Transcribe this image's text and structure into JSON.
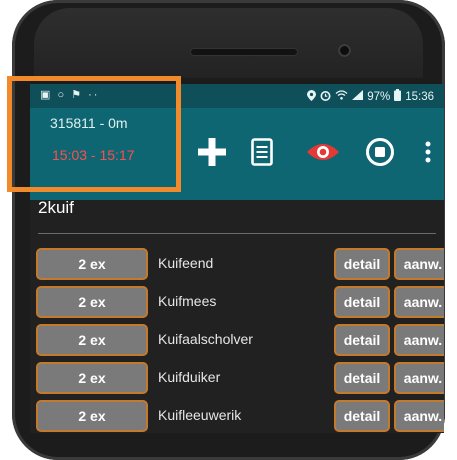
{
  "status_bar": {
    "left_icons": [
      "image-icon",
      "instagram-icon",
      "flag-icon",
      "more-dots-icon"
    ],
    "right_icons": [
      "location-icon",
      "alarm-icon",
      "wifi-icon",
      "signal-icon",
      "battery-icon"
    ],
    "battery": "97%",
    "time": "15:36"
  },
  "app_bar": {
    "subtitle_location": "315811 - 0m",
    "subtitle_time_range": "15:03 - 15:17",
    "actions": [
      {
        "name": "add",
        "icon": "plus-icon"
      },
      {
        "name": "notes",
        "icon": "document-icon"
      },
      {
        "name": "view",
        "icon": "eye-icon"
      },
      {
        "name": "stop",
        "icon": "stop-circle-icon"
      },
      {
        "name": "menu",
        "icon": "more-vertical-icon"
      }
    ],
    "colors": {
      "app_bar": "#0f6673",
      "status_bar": "#0f4f5a",
      "time_range": "#ff4d4d",
      "eye": "#e53935"
    }
  },
  "section": {
    "title": "2kuif"
  },
  "rows": [
    {
      "qty": "2 ex",
      "species": "Kuifeend",
      "detail": "detail",
      "aanw": "aanw."
    },
    {
      "qty": "2 ex",
      "species": "Kuifmees",
      "detail": "detail",
      "aanw": "aanw."
    },
    {
      "qty": "2 ex",
      "species": "Kuifaalscholver",
      "detail": "detail",
      "aanw": "aanw."
    },
    {
      "qty": "2 ex",
      "species": "Kuifduiker",
      "detail": "detail",
      "aanw": "aanw."
    },
    {
      "qty": "2 ex",
      "species": "Kuifleeuwerik",
      "detail": "detail",
      "aanw": "aanw."
    }
  ],
  "highlight_color": "#f08a2a",
  "button_border_color": "#c47a2c"
}
